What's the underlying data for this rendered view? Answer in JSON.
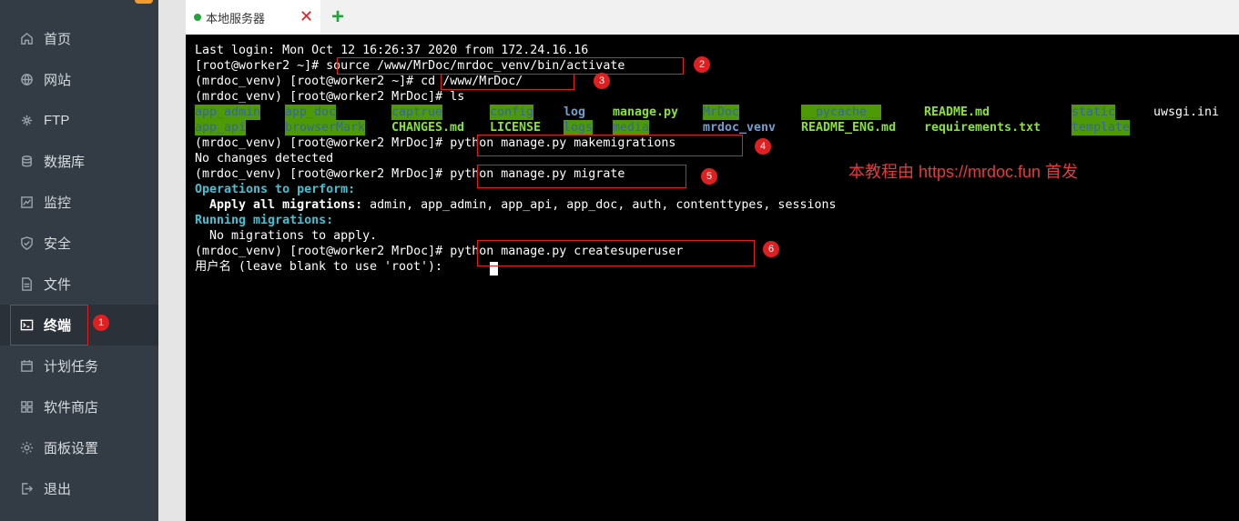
{
  "sidebar": {
    "items": [
      {
        "label": "首页",
        "icon": "home-icon"
      },
      {
        "label": "网站",
        "icon": "globe-icon"
      },
      {
        "label": "FTP",
        "icon": "ftp-icon"
      },
      {
        "label": "数据库",
        "icon": "database-icon"
      },
      {
        "label": "监控",
        "icon": "monitor-icon"
      },
      {
        "label": "安全",
        "icon": "shield-icon"
      },
      {
        "label": "文件",
        "icon": "folder-icon"
      },
      {
        "label": "终端",
        "icon": "terminal-icon",
        "active": true
      },
      {
        "label": "计划任务",
        "icon": "calendar-icon"
      },
      {
        "label": "软件商店",
        "icon": "grid-icon"
      },
      {
        "label": "面板设置",
        "icon": "gear-icon"
      },
      {
        "label": "退出",
        "icon": "logout-icon"
      }
    ]
  },
  "tabs": {
    "active_label": "本地服务器",
    "close_glyph": "✕",
    "add_glyph": "+"
  },
  "terminal": {
    "last_login": "Last login: Mon Oct 12 16:26:37 2020 from 172.24.16.16",
    "l2_prompt": "[root@worker2 ~]# ",
    "l2_cmd": "source /www/MrDoc/mrdoc_venv/bin/activate",
    "l3_prompt": "(mrdoc_venv) [root@worker2 ~]# ",
    "l3_cmd": "cd /www/MrDoc/",
    "l4": "(mrdoc_venv) [root@worker2 MrDoc]# ls",
    "ls_row1": [
      "app_admin",
      "app_doc",
      "captrue",
      "config",
      "log",
      "manage.py",
      "MrDoc",
      "__pycache__",
      "README.md",
      "static",
      "uwsgi.ini"
    ],
    "ls_row2": [
      "app_api",
      "browserMark",
      "CHANGES.md",
      "LICENSE",
      "logs",
      "media",
      "mrdoc_venv",
      "README_ENG.md",
      "requirements.txt",
      "template"
    ],
    "prompt_mrdoc": "(mrdoc_venv) [root@worker2 MrDoc]# ",
    "cmd_makemigrations": "python manage.py makemigrations",
    "no_changes": "No changes detected",
    "cmd_migrate": "python manage.py migrate",
    "ops_header": "Operations to perform:",
    "apply_label": "  Apply all migrations:",
    "apply_list": " admin, app_admin, app_api, app_doc, auth, contenttypes, sessions",
    "running": "Running migrations:",
    "no_migrations": "  No migrations to apply.",
    "cmd_createsuperuser": "python manage.py createsuperuser",
    "username_prompt": "用户名 (leave blank to use 'root'): "
  },
  "annotations": {
    "badges": [
      "1",
      "2",
      "3",
      "4",
      "5",
      "6"
    ],
    "watermark": "本教程由 https://mrdoc.fun 首发"
  },
  "colors": {
    "sidebar_bg": "#333c44",
    "accent_green": "#20a53a",
    "annotation_red": "#e02020",
    "terminal_bg": "#000000"
  }
}
